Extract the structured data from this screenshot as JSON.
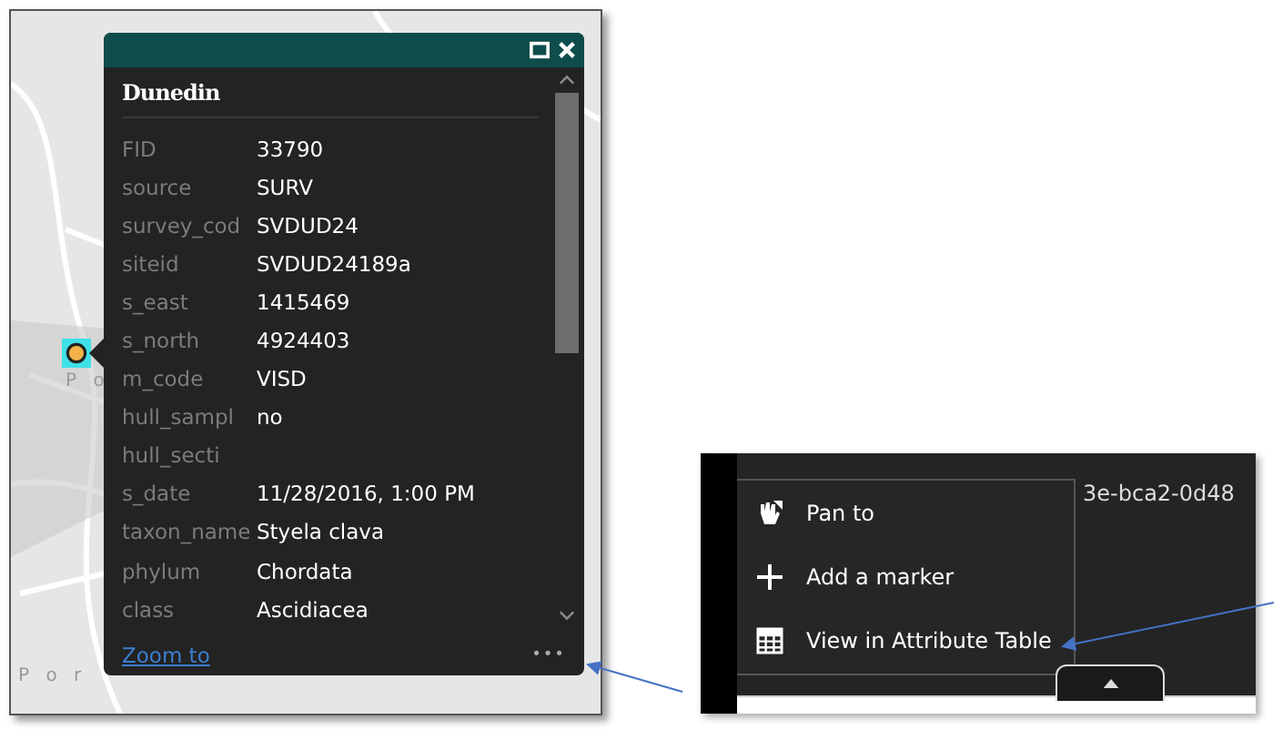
{
  "map_labels": [
    "P o",
    "P o r"
  ],
  "popup": {
    "title": "Dunedin",
    "fields": [
      {
        "label": "FID",
        "value": "33790"
      },
      {
        "label": "source",
        "value": "SURV"
      },
      {
        "label": "survey_cod",
        "value": "SVDUD24"
      },
      {
        "label": "siteid",
        "value": "SVDUD24189a"
      },
      {
        "label": "s_east",
        "value": "1415469"
      },
      {
        "label": "s_north",
        "value": "4924403"
      },
      {
        "label": "m_code",
        "value": "VISD"
      },
      {
        "label": "hull_sampl",
        "value": "no"
      },
      {
        "label": "hull_secti"
      },
      {
        "label": "s_date",
        "value": "11/28/2016, 1:00 PM"
      },
      {
        "label": "taxon_name",
        "value": "Styela clava"
      },
      {
        "label": "phylum",
        "value": "Chordata"
      },
      {
        "label": "class",
        "value": "Ascidiacea"
      }
    ],
    "zoom_link": "Zoom to",
    "more": "•••"
  },
  "detail": {
    "id_fragment": "3e-bca2-0d48",
    "menu": [
      {
        "kind": "pan",
        "label": "Pan to"
      },
      {
        "kind": "add",
        "label": "Add a marker"
      },
      {
        "kind": "table",
        "label": "View in Attribute Table"
      }
    ]
  }
}
